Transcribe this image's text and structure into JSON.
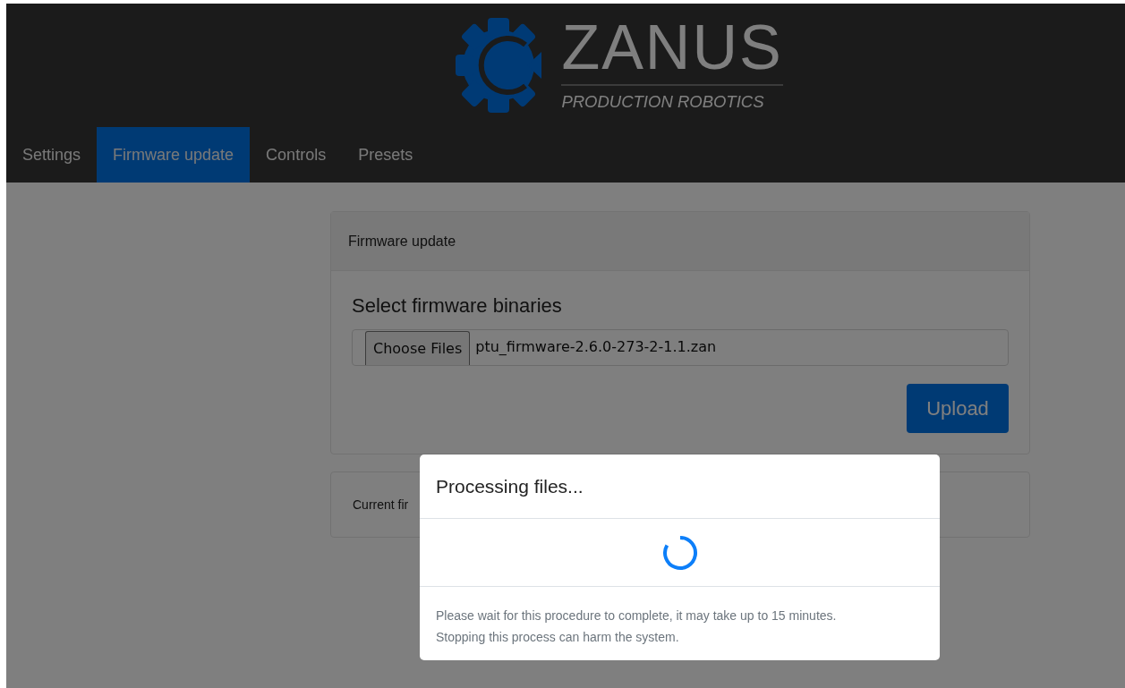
{
  "logo": {
    "name": "ZANUS",
    "tagline": "PRODUCTION ROBOTICS"
  },
  "tabs": [
    {
      "label": "Settings",
      "selected": false
    },
    {
      "label": "Firmware update",
      "selected": true
    },
    {
      "label": "Controls",
      "selected": false
    },
    {
      "label": "Presets",
      "selected": false
    }
  ],
  "firmware_card": {
    "title": "Firmware update",
    "heading": "Select firmware binaries",
    "file_button": "Choose Files",
    "file_name": "ptu_firmware-2.6.0-273-2-1.1.zan",
    "upload_button": "Upload"
  },
  "current_card": {
    "text": "Current fir"
  },
  "modal": {
    "title": "Processing files...",
    "message_lines": [
      "Please wait for this procedure to complete, it may take up to 15 minutes.",
      "Stopping this process can harm the system."
    ]
  }
}
